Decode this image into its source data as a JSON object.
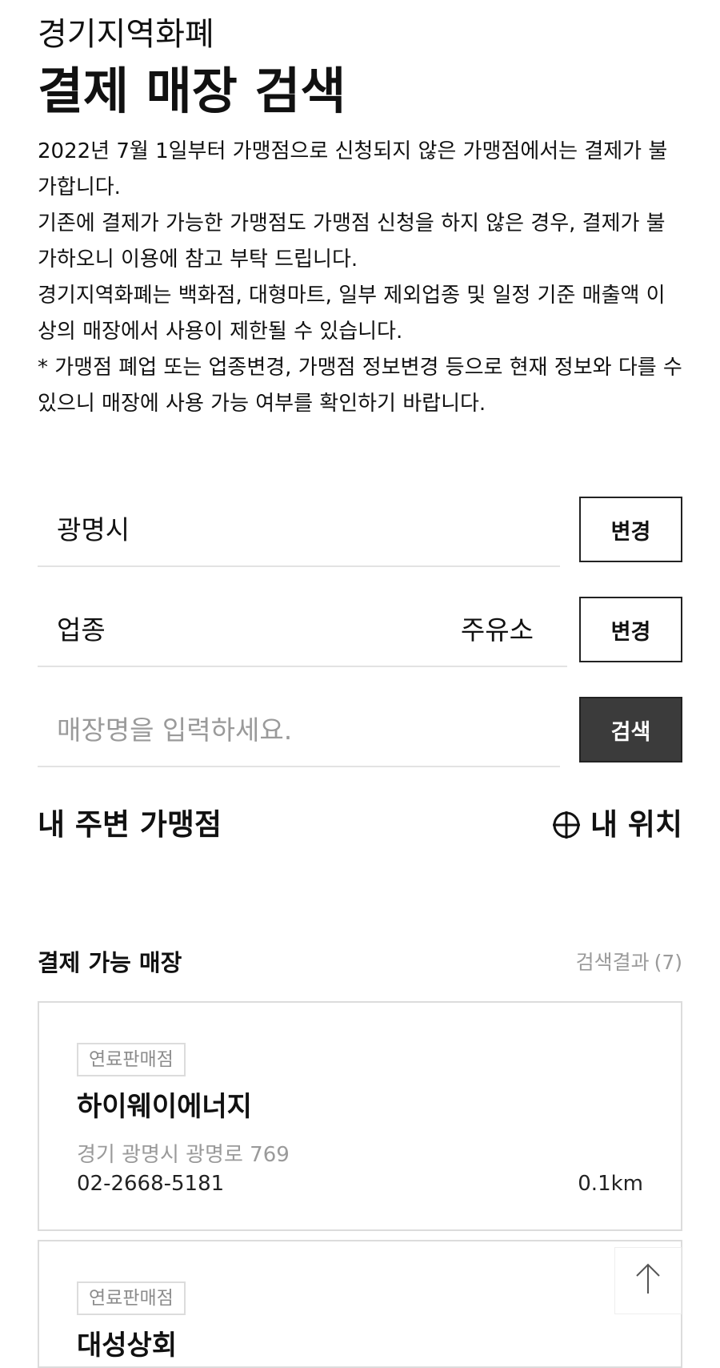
{
  "header": {
    "subtitle": "경기지역화폐",
    "title": "결제 매장 검색"
  },
  "notice": [
    "2022년 7월 1일부터 가맹점으로 신청되지 않은 가맹점에서는 결제가 불가합니다.",
    "기존에 결제가 가능한 가맹점도 가맹점 신청을 하지 않은 경우, 결제가 불가하오니 이용에 참고 부탁 드립니다.",
    "경기지역화폐는 백화점, 대형마트, 일부 제외업종 및 일정 기준 매출액 이상의 매장에서 사용이 제한될 수 있습니다.",
    "* 가맹점 폐업 또는 업종변경, 가맹점 정보변경 등으로 현재 정보와 다를 수 있으니 매장에 사용 가능 여부를 확인하기 바랍니다."
  ],
  "search": {
    "region": {
      "value": "광명시",
      "button_label": "변경"
    },
    "category": {
      "label": "업종",
      "value": "주유소",
      "button_label": "변경"
    },
    "store_name": {
      "value": "",
      "placeholder": "매장명을 입력하세요.",
      "button_label": "검색"
    }
  },
  "nearby": {
    "title": "내 주변 가맹점",
    "location_label": "내 위치",
    "location_icon": "crosshair-icon"
  },
  "results": {
    "title": "결제 가능 매장",
    "count_label": "검색결과",
    "count": "(7)",
    "items": [
      {
        "badge": "연료판매점",
        "name": "하이웨이에너지",
        "address": "경기 광명시 광명로 769",
        "phone": "02-2668-5181",
        "distance": "0.1km"
      },
      {
        "badge": "연료판매점",
        "name": "대성상회"
      }
    ]
  },
  "scroll_top": {
    "icon": "arrow-up-icon"
  },
  "colors": {
    "text": "#111111",
    "muted": "#9a9a9a",
    "border": "#dcdcdc",
    "search_button_bg": "#3b3b3b",
    "background": "#ffffff"
  }
}
